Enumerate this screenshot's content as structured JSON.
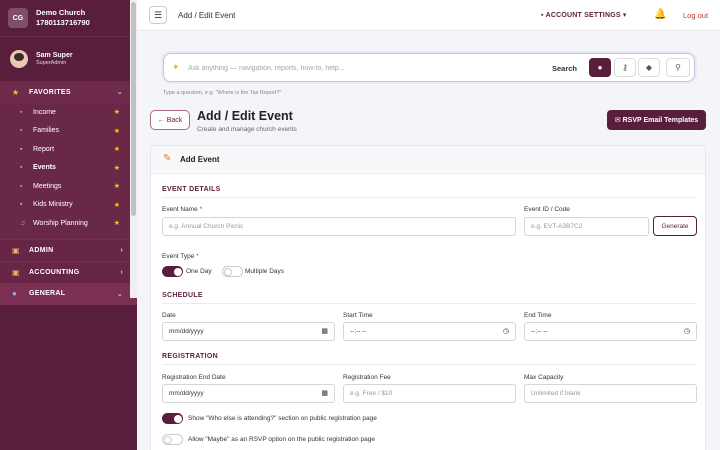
{
  "sidebar": {
    "logo_initials": "CG",
    "org_name": "Demo Church",
    "org_phone": "1780113716790",
    "user_name": "Sam Super",
    "user_role": "SuperAdmin",
    "sections": {
      "favorites": "FAVORITES",
      "admin": "ADMIN",
      "accounting": "ACCOUNTING",
      "general": "GENERAL"
    },
    "items": [
      {
        "label": "Income",
        "icon": "money-icon"
      },
      {
        "label": "Families",
        "icon": "family-icon"
      },
      {
        "label": "Report",
        "icon": "report-icon"
      },
      {
        "label": "Events",
        "icon": "events-icon"
      },
      {
        "label": "Meetings",
        "icon": "meetings-icon"
      },
      {
        "label": "Kids Ministry",
        "icon": "kids-icon"
      },
      {
        "label": "Worship Planning",
        "icon": "music-icon"
      }
    ]
  },
  "topbar": {
    "title": "Add / Edit Event",
    "account_settings": "ACCOUNT SETTINGS",
    "logout": "Log out"
  },
  "search": {
    "placeholder": "Ask anything — navigation, reports, how-to, help...",
    "button_label": "Search",
    "hint": "Type a question, e.g. \"Where is the Tax Report?\""
  },
  "page": {
    "back_label": "Back",
    "title": "Add / Edit Event",
    "subtitle": "Create and manage church events",
    "rsvp_button": "RSVP Email Templates"
  },
  "form": {
    "card_title": "Add Event",
    "sections": {
      "event_details": "EVENT DETAILS",
      "schedule": "SCHEDULE",
      "registration": "REGISTRATION"
    },
    "event_name_label": "Event Name",
    "event_name_placeholder": "e.g. Annual Church Picnic",
    "event_id_label": "Event ID / Code",
    "event_id_placeholder": "e.g. EVT-A3B7C2",
    "generate_button": "Generate",
    "event_type_label": "Event Type",
    "one_day_label": "One Day",
    "multiple_days_label": "Multiple Days",
    "date_label": "Date",
    "date_value": "mm/dd/yyyy",
    "start_time_label": "Start Time",
    "start_time_value": "--:-- --",
    "end_time_label": "End Time",
    "end_time_value": "--:-- --",
    "reg_end_label": "Registration End Date",
    "reg_end_value": "mm/dd/yyyy",
    "reg_fee_label": "Registration Fee",
    "reg_fee_placeholder": "e.g. Free / $10",
    "max_cap_label": "Max Capacity",
    "max_cap_placeholder": "Unlimited if blank",
    "show_attending_label": "Show \"Who else is attending?\" section on public registration page",
    "allow_maybe_label": "Allow \"Maybe\" as an RSVP option on the public registration page"
  }
}
